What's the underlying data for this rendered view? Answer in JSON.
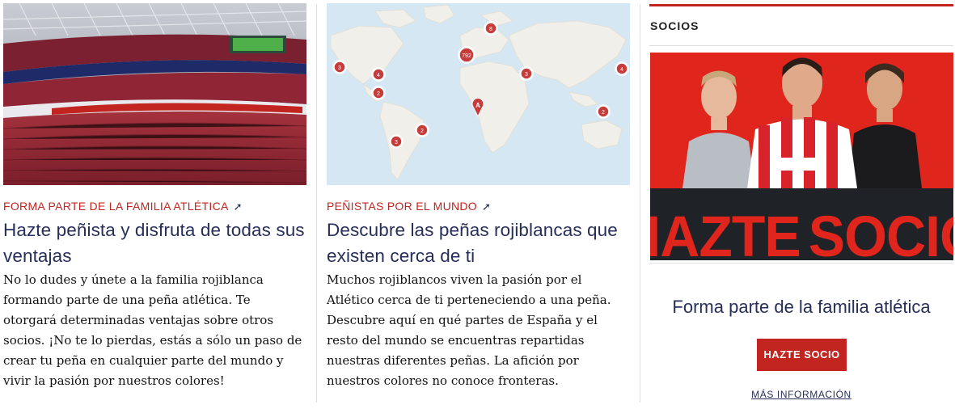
{
  "cards": [
    {
      "kicker": "FORMA PARTE DE LA FAMILIA ATLÉTICA",
      "arrow": "➚",
      "title": "Hazte peñista y disfruta de todas sus ventajas",
      "body": "No lo dudes y únete a la familia rojiblanca formando parte de una peña atlética. Te otorgará determinadas ventajas sobre otros socios. ¡No te lo pierdas, estás a sólo un paso de crear tu peña en cualquier parte del mundo y vivir la pasión por nuestros colores!"
    },
    {
      "kicker": "PEÑISTAS POR EL MUNDO",
      "arrow": "➚",
      "title": "Descubre las peñas rojiblancas que existen cerca de ti",
      "body": "Muchos rojiblancos viven la pasión por el Atlético cerca de ti perteneciendo a una peña. Descubre aquí en qué partes de España y el resto del mundo se encuentras repartidas nuestras diferentes peñas. La afición por nuestros colores no conoce fronteras."
    }
  ],
  "map_markers": [
    "8",
    "3",
    "4",
    "2",
    "792",
    "3",
    "4",
    "2",
    "3",
    "2",
    "A"
  ],
  "socios": {
    "label": "SOCIOS",
    "banner_text_1": "HAZTE",
    "banner_text_2": "SOCIO",
    "cta_title": "Forma parte de la familia atlética",
    "cta_button": "HAZTE SOCIO",
    "more_link": "MÁS INFORMACIÓN"
  },
  "colors": {
    "accent": "#c2241f",
    "navy": "#262f5a",
    "map_water": "#d4e7f3",
    "map_land": "#f1efe9"
  }
}
